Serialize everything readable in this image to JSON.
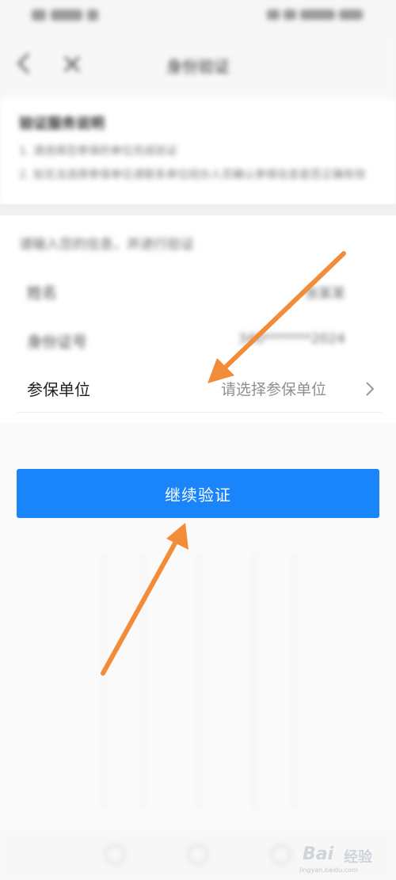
{
  "status_bar": {},
  "nav": {
    "title": "身份验证"
  },
  "tips": {
    "title": "验证服务说明",
    "line1": "1. 请选择您参保的单位完成验证",
    "line2": "2. 如无法选择参保单位请联系单位经办人员确认参保信息是否正确有效"
  },
  "form": {
    "hint": "请输入您的信息，并进行验证",
    "row1": {
      "label": "姓名",
      "value": "张某某"
    },
    "row2": {
      "label": "身份证号",
      "value": "340*******2024"
    },
    "unit": {
      "label": "参保单位",
      "placeholder": "请选择参保单位"
    }
  },
  "button": {
    "label": "继续验证"
  },
  "watermark": {
    "brand": "Bai",
    "cn": "经验",
    "url": "jingyan.baidu.com"
  },
  "colors": {
    "primary": "#1a84fb",
    "arrow": "#f28c38"
  }
}
